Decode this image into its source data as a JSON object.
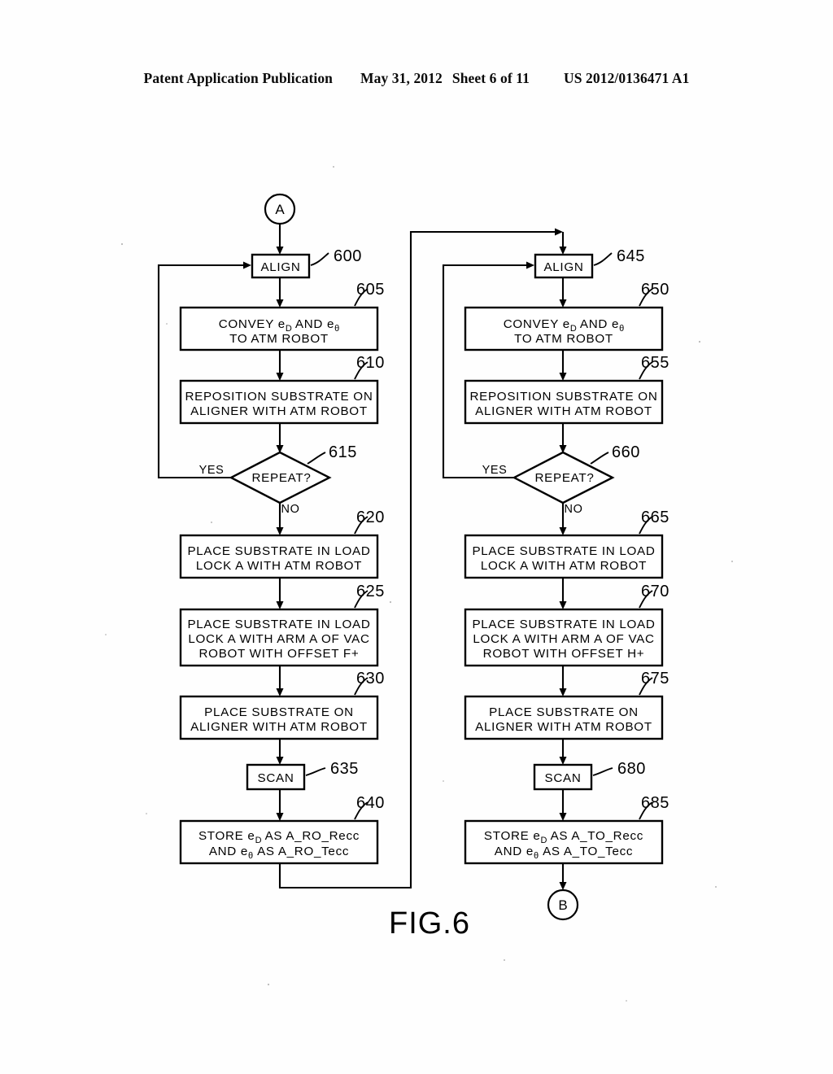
{
  "header": {
    "publication": "Patent Application Publication",
    "date": "May 31, 2012",
    "sheet": "Sheet 6 of 11",
    "docnum": "US 2012/0136471 A1"
  },
  "figure": {
    "caption": "FIG.6"
  },
  "connectors": {
    "entry": "A",
    "exit": "B"
  },
  "labels": {
    "yes": "YES",
    "no": "NO"
  },
  "left_column": {
    "align": {
      "ref": "600",
      "text": "ALIGN"
    },
    "convey": {
      "ref": "605",
      "line1_pre": "CONVEY e",
      "line1_sub1": "D",
      "line1_mid": " AND e",
      "line1_sub2": "θ",
      "line2": "TO ATM ROBOT"
    },
    "reposition": {
      "ref": "610",
      "line1": "REPOSITION SUBSTRATE ON",
      "line2": "ALIGNER WITH ATM ROBOT"
    },
    "repeat": {
      "ref": "615",
      "text": "REPEAT?"
    },
    "place_ll_atm": {
      "ref": "620",
      "line1": "PLACE SUBSTRATE IN LOAD",
      "line2": "LOCK A WITH ATM ROBOT"
    },
    "place_ll_vac": {
      "ref": "625",
      "line1": "PLACE SUBSTRATE IN LOAD",
      "line2": "LOCK A WITH ARM A OF VAC",
      "line3": "ROBOT WITH OFFSET F+"
    },
    "place_aligner": {
      "ref": "630",
      "line1": "PLACE SUBSTRATE ON",
      "line2": "ALIGNER   WITH ATM ROBOT"
    },
    "scan": {
      "ref": "635",
      "text": "SCAN"
    },
    "store": {
      "ref": "640",
      "line1_pre": "STORE e",
      "line1_sub": "D",
      "line1_post": "  AS A_RO_Recc",
      "line2_pre": "AND e",
      "line2_sub": "θ",
      "line2_post": " AS A_RO_Tecc"
    }
  },
  "right_column": {
    "align": {
      "ref": "645",
      "text": "ALIGN"
    },
    "convey": {
      "ref": "650",
      "line1_pre": "CONVEY e",
      "line1_sub1": "D",
      "line1_mid": " AND e",
      "line1_sub2": "θ",
      "line2": "TO ATM ROBOT"
    },
    "reposition": {
      "ref": "655",
      "line1": "REPOSITION SUBSTRATE ON",
      "line2": "ALIGNER WITH ATM ROBOT"
    },
    "repeat": {
      "ref": "660",
      "text": "REPEAT?"
    },
    "place_ll_atm": {
      "ref": "665",
      "line1": "PLACE SUBSTRATE IN LOAD",
      "line2": "LOCK A WITH ATM ROBOT"
    },
    "place_ll_vac": {
      "ref": "670",
      "line1": "PLACE SUBSTRATE IN LOAD",
      "line2": "LOCK A WITH ARM A OF VAC",
      "line3": "ROBOT WITH OFFSET H+"
    },
    "place_aligner": {
      "ref": "675",
      "line1": "PLACE SUBSTRATE ON",
      "line2": "ALIGNER   WITH ATM ROBOT"
    },
    "scan": {
      "ref": "680",
      "text": "SCAN"
    },
    "store": {
      "ref": "685",
      "line1_pre": "STORE e",
      "line1_sub": "D",
      "line1_post": "  AS A_TO_Recc",
      "line2_pre": "AND e",
      "line2_sub": "θ",
      "line2_post": " AS A_TO_Tecc"
    }
  }
}
